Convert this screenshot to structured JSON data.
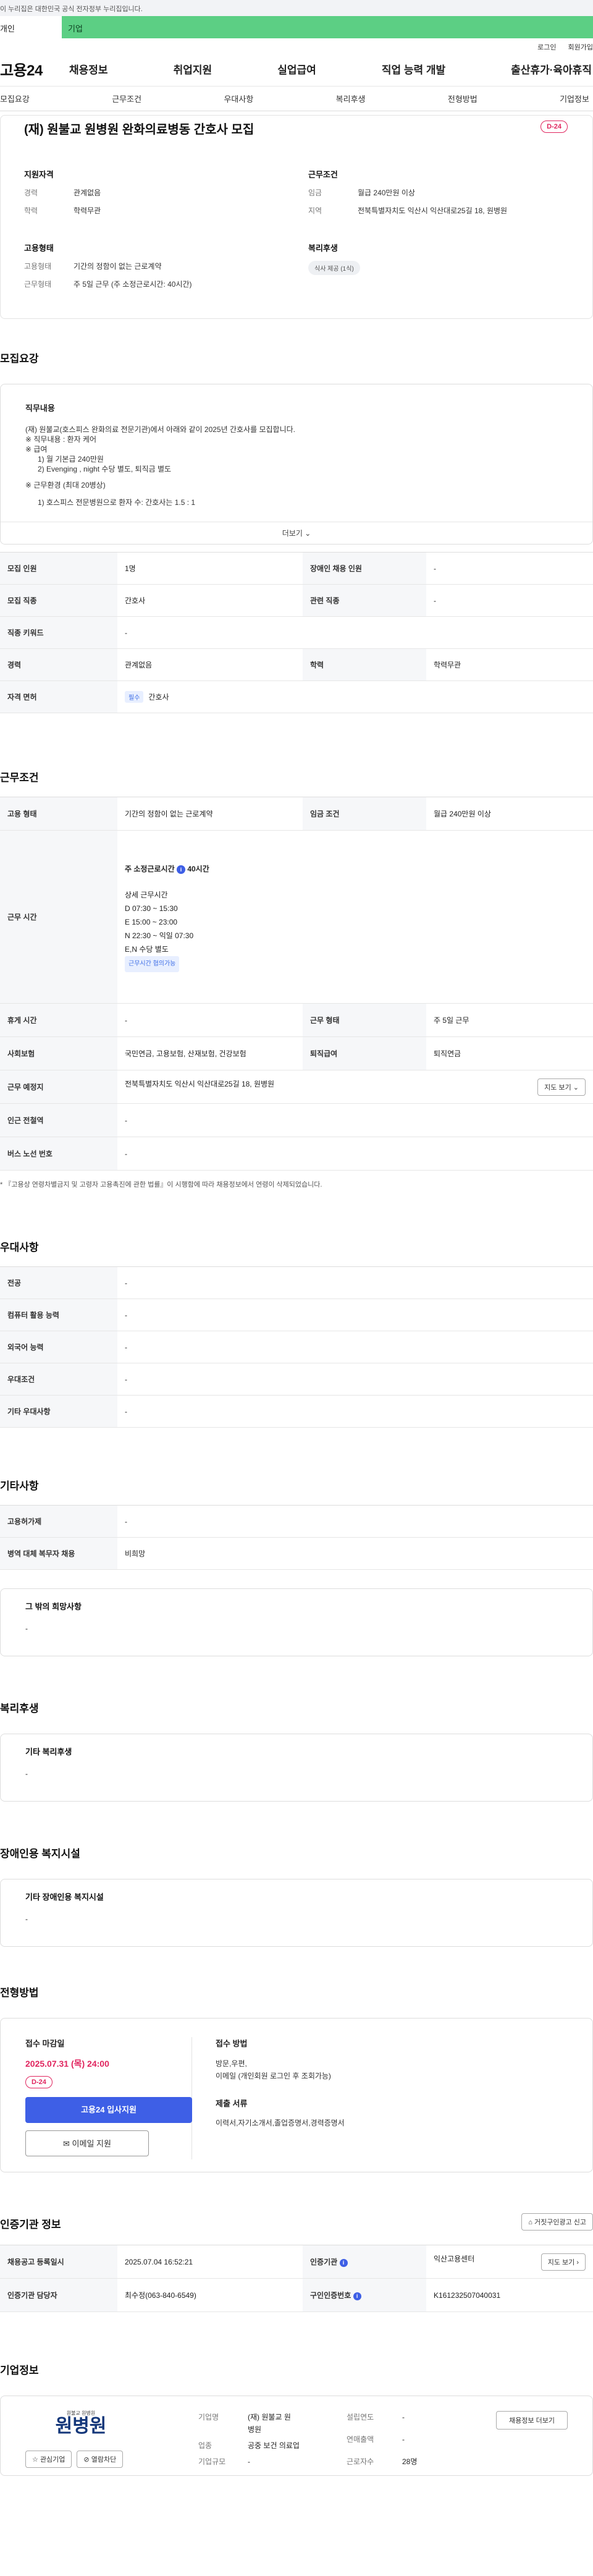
{
  "gov_notice": "이 누리집은 대한민국 공식 전자정부 누리집입니다.",
  "segment": {
    "person": "개인",
    "company": "기업"
  },
  "util": {
    "login": "로그인",
    "signup": "회원가입"
  },
  "logo": "고용24",
  "gnb": [
    "채용정보",
    "취업지원",
    "실업급여",
    "직업 능력 개발",
    "출산휴가·육아휴직"
  ],
  "subnav": [
    "모집요강",
    "근무조건",
    "우대사항",
    "복리후생",
    "전형방법",
    "기업정보"
  ],
  "title": "(재) 원불교 원병원 완화의료병동 간호사 모집",
  "dday": "D-24",
  "summary": {
    "qual_head": "지원자격",
    "career_k": "경력",
    "career_v": "관계없음",
    "edu_k": "학력",
    "edu_v": "학력무관",
    "cond_head": "근무조건",
    "wage_k": "임금",
    "wage_v": "월급 240만원 이상",
    "loc_k": "지역",
    "loc_v": "전북특별자치도 익산시 익산대로25길 18, 원병원",
    "type_head": "고용형태",
    "emp_k": "고용형태",
    "emp_v": "기간의 정함이 없는 근로계약",
    "work_k": "근무형태",
    "work_v": "주 5일 근무 (주 소정근로시간: 40시간)",
    "welfare_head": "복리후생",
    "welfare_chip": "식사 제공 (1식)"
  },
  "recruit": {
    "heading": "모집요강",
    "duty_head": "직무내용",
    "duty_lines": [
      "(재) 원불교(호스피스 완화의료 전문기관)에서 아래와 같이 2025년 간호사를 모집합니다.",
      "※ 직무내용 : 환자 케어",
      "※ 급여",
      "1) 월  기본급 240만원",
      "2) Evenging , night 수당 별도, 퇴직금 별도",
      "",
      "※ 근무환경 (최대 20병상)",
      "",
      "1) 호스피스 전문병원으로 환자 수: 간호사는 1.5 : 1"
    ],
    "more": "더보기",
    "rows": [
      {
        "k1": "모집 인원",
        "v1": "1명",
        "k2": "장애인 채용 인원",
        "v2": "-"
      },
      {
        "k1": "모집 직종",
        "v1": "간호사",
        "k2": "관련 직종",
        "v2": "-"
      },
      {
        "k1": "직종 키워드",
        "v1": "-"
      },
      {
        "k1": "경력",
        "v1": "관계없음",
        "k2": "학력",
        "v2": "학력무관"
      },
      {
        "k1": "자격 면허",
        "badge": "필수",
        "v1": "간호사"
      }
    ]
  },
  "conditions": {
    "heading": "근무조건",
    "emp_k": "고용 형태",
    "emp_v": "기간의 정함이 없는 근로계약",
    "wage_k": "임금 조건",
    "wage_v": "월급 240만원 이상",
    "hours_k": "근무 시간",
    "hours_weekly": "주 소정근로시간",
    "hours_weekly_v": "40시간",
    "hours_detail_head": "상세 근무시간",
    "hours_lines": [
      "D 07:30 ~ 15:30",
      "E 15:00 ~ 23:00",
      "N 22:30 ~ 익일 07:30",
      "E,N 수당 별도"
    ],
    "hours_badge": "근무시간 협의가능",
    "break_k": "휴게 시간",
    "break_v": "-",
    "form_k": "근무 형태",
    "form_v": "주 5일 근무",
    "ins_k": "사회보험",
    "ins_v": "국민연금, 고용보험, 산재보험, 건강보험",
    "ret_k": "퇴직급여",
    "ret_v": "퇴직연금",
    "place_k": "근무 예정지",
    "place_v": "전북특별자치도 익산시 익산대로25길 18, 원병원",
    "map_btn": "지도 보기",
    "subway_k": "인근 전철역",
    "subway_v": "-",
    "bus_k": "버스 노선 번호",
    "bus_v": "-",
    "note": "* 『고용상 연령차별금지 및 고령자 고용촉진에 관한 법률』이 시행함에 따라 채용정보에서 연령이 삭제되었습니다."
  },
  "preference": {
    "heading": "우대사항",
    "rows": [
      {
        "k": "전공",
        "v": "-"
      },
      {
        "k": "컴퓨터 활용 능력",
        "v": "-"
      },
      {
        "k": "외국어 능력",
        "v": "-"
      },
      {
        "k": "우대조건",
        "v": "-"
      },
      {
        "k": "기타 우대사항",
        "v": "-"
      }
    ]
  },
  "etc": {
    "heading": "기타사항",
    "rows": [
      {
        "k": "고용허가제",
        "v": "-"
      },
      {
        "k": "병역 대체 복무자 채용",
        "v": "비희망"
      }
    ],
    "other_head": "그 밖의 희망사항",
    "other_v": "-"
  },
  "welfare": {
    "heading": "복리후생",
    "box_head": "기타 복리후생",
    "box_v": "-"
  },
  "disability": {
    "heading": "장애인용 복지시설",
    "box_head": "기타 장애인용 복지시설",
    "box_v": "-"
  },
  "selection": {
    "heading": "전형방법",
    "deadline_head": "접수 마감일",
    "deadline_v": "2025.07.31 (목) 24:00",
    "dday": "D-24",
    "apply_btn": "고용24 입사지원",
    "email_btn": "이메일 지원",
    "method_head": "접수 방법",
    "method_v1": "방문,우편,",
    "method_v2": "이메일 (개인회원 로그인 후 조회가능)",
    "docs_head": "제출 서류",
    "docs_v": "이력서,자기소개서,졸업증명서,경력증명서"
  },
  "agency": {
    "heading": "인증기관 정보",
    "report_btn": "거짓구인광고 신고",
    "reg_k": "채용공고 등록일시",
    "reg_v": "2025.07.04 16:52:21",
    "org_k": "인증기관",
    "org_v": "익산고용센터",
    "map_btn": "지도 보기",
    "mgr_k": "인증기관 담당자",
    "mgr_v": "최수정(063-840-6549)",
    "jobno_k": "구인인증번호",
    "jobno_v": "K161232507040031"
  },
  "company": {
    "heading": "기업정보",
    "logo_small": "원불교 원병원",
    "logo_big": "원병원",
    "fav_btn": "관심기업",
    "block_btn": "열람차단",
    "name_k": "기업명",
    "name_v1": "(재) 원불교 원",
    "name_v2": "병원",
    "industry_k": "업종",
    "industry_v": "공중 보건 의료업",
    "size_k": "기업규모",
    "size_v": "-",
    "founded_k": "설립연도",
    "founded_v": "-",
    "revenue_k": "연매출액",
    "revenue_v": "-",
    "staff_k": "근로자수",
    "staff_v": "28명",
    "jobs_btn": "채용정보 더보기"
  }
}
